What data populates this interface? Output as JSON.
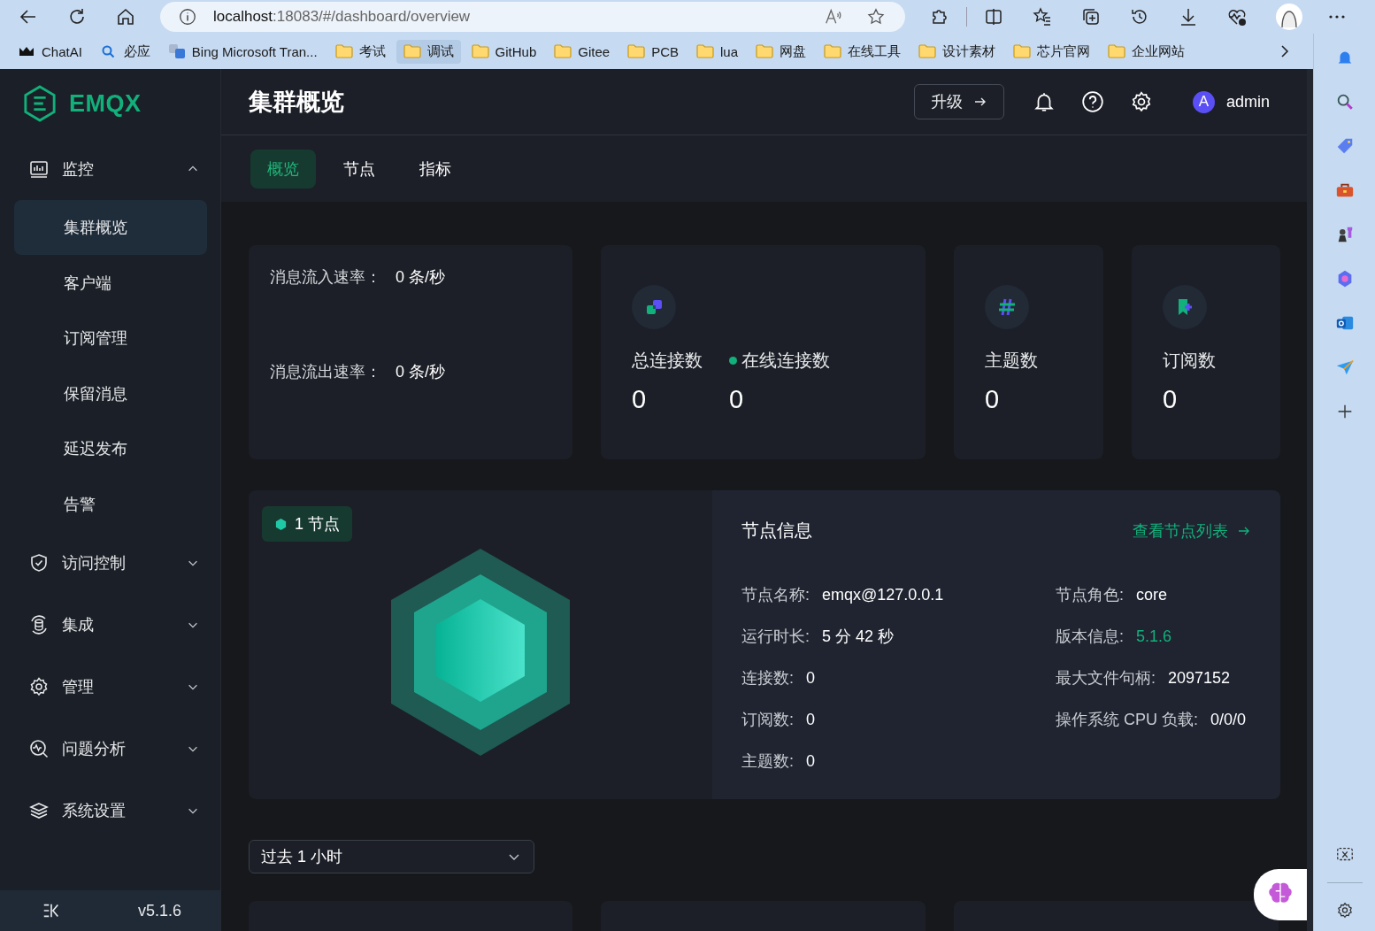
{
  "browser": {
    "address": {
      "host": "localhost",
      "path": ":18083/#/dashboard/overview"
    },
    "bookmarks": [
      {
        "label": "ChatAI",
        "kind": "crown",
        "selected": false
      },
      {
        "label": "必应",
        "kind": "search",
        "selected": false
      },
      {
        "label": "Bing Microsoft Tran...",
        "kind": "translate",
        "selected": false
      },
      {
        "label": "考试",
        "kind": "folder",
        "selected": false
      },
      {
        "label": "调试",
        "kind": "folder",
        "selected": true
      },
      {
        "label": "GitHub",
        "kind": "folder",
        "selected": false
      },
      {
        "label": "Gitee",
        "kind": "folder",
        "selected": false
      },
      {
        "label": "PCB",
        "kind": "folder",
        "selected": false
      },
      {
        "label": "lua",
        "kind": "folder",
        "selected": false
      },
      {
        "label": "网盘",
        "kind": "folder",
        "selected": false
      },
      {
        "label": "在线工具",
        "kind": "folder",
        "selected": false
      },
      {
        "label": "设计素材",
        "kind": "folder",
        "selected": false
      },
      {
        "label": "芯片官网",
        "kind": "folder",
        "selected": false
      },
      {
        "label": "企业网站",
        "kind": "folder",
        "selected": false
      }
    ]
  },
  "sidebar": {
    "logo": "EMQX",
    "version": "v5.1.6",
    "items": [
      {
        "label": "监控",
        "kind": "monitor",
        "expanded": true,
        "children": [
          {
            "label": "集群概览",
            "selected": true
          },
          {
            "label": "客户端",
            "selected": false
          },
          {
            "label": "订阅管理",
            "selected": false
          },
          {
            "label": "保留消息",
            "selected": false
          },
          {
            "label": "延迟发布",
            "selected": false
          },
          {
            "label": "告警",
            "selected": false
          }
        ]
      },
      {
        "label": "访问控制",
        "kind": "shield",
        "expanded": false
      },
      {
        "label": "集成",
        "kind": "integration",
        "expanded": false
      },
      {
        "label": "管理",
        "kind": "manage",
        "expanded": false
      },
      {
        "label": "问题分析",
        "kind": "analysis",
        "expanded": false
      },
      {
        "label": "系统设置",
        "kind": "layers",
        "expanded": false
      }
    ]
  },
  "header": {
    "title": "集群概览",
    "upgrade_button": "升级",
    "avatar": "A",
    "user": "admin"
  },
  "tabs": [
    {
      "label": "概览",
      "selected": true
    },
    {
      "label": "节点",
      "selected": false
    },
    {
      "label": "指标",
      "selected": false
    }
  ],
  "rates": [
    {
      "label": "消息流入速率：",
      "value": "0 条/秒"
    },
    {
      "label": "消息流出速率：",
      "value": "0 条/秒"
    }
  ],
  "stats": [
    {
      "kind": "connections",
      "items": [
        {
          "label": "总连接数",
          "value": "0",
          "online": false
        },
        {
          "label": "在线连接数",
          "value": "0",
          "online": true
        }
      ]
    },
    {
      "kind": "topics",
      "items": [
        {
          "label": "主题数",
          "value": "0",
          "online": false
        }
      ]
    },
    {
      "kind": "subscriptions",
      "items": [
        {
          "label": "订阅数",
          "value": "0",
          "online": false
        }
      ]
    }
  ],
  "node_badge": "1 节点",
  "node_info": {
    "title": "节点信息",
    "link": "查看节点列表",
    "left": [
      {
        "label": "节点名称:",
        "value": "emqx@127.0.0.1",
        "accent": false
      },
      {
        "label": "运行时长:",
        "value": "5 分 42 秒",
        "accent": false
      },
      {
        "label": "连接数:",
        "value": "0",
        "accent": false
      },
      {
        "label": "订阅数:",
        "value": "0",
        "accent": false
      },
      {
        "label": "主题数:",
        "value": "0",
        "accent": false
      }
    ],
    "right": [
      {
        "label": "节点角色:",
        "value": "core",
        "accent": false
      },
      {
        "label": "版本信息:",
        "value": "5.1.6",
        "accent": true
      },
      {
        "label": "最大文件句柄:",
        "value": "2097152",
        "accent": false
      },
      {
        "label": "操作系统 CPU 负载:",
        "value": "0/0/0",
        "accent": false
      }
    ]
  },
  "time_select": {
    "value": "过去 1 小时"
  }
}
